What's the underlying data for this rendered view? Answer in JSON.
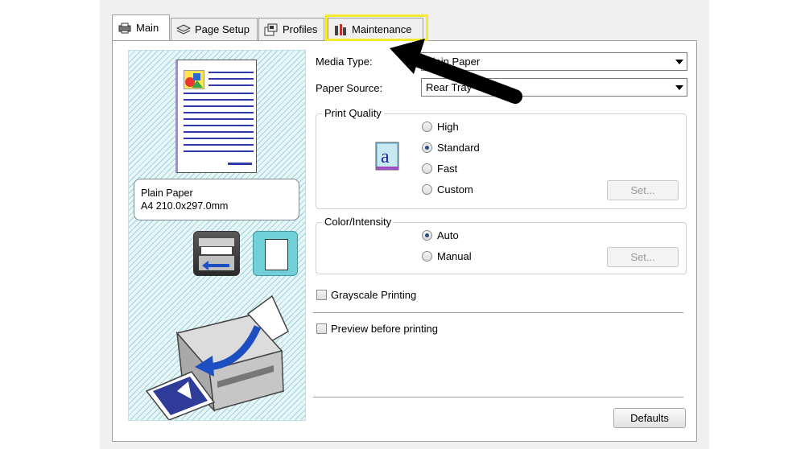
{
  "tabs": [
    {
      "label": "Main",
      "icon": "printer-icon",
      "active": true
    },
    {
      "label": "Page Setup",
      "icon": "page-layers-icon",
      "active": false
    },
    {
      "label": "Profiles",
      "icon": "profiles-icon",
      "active": false
    },
    {
      "label": "Maintenance",
      "icon": "maintenance-tools-icon",
      "active": false
    }
  ],
  "preview": {
    "paper_line1": "Plain Paper",
    "paper_line2": "A4 210.0x297.0mm"
  },
  "media_type": {
    "label": "Media Type:",
    "value": "Plain Paper"
  },
  "paper_source": {
    "label": "Paper Source:",
    "value": "Rear Tray"
  },
  "print_quality": {
    "title": "Print Quality",
    "options": [
      "High",
      "Standard",
      "Fast",
      "Custom"
    ],
    "selected": "Standard",
    "set_label": "Set..."
  },
  "color_intensity": {
    "title": "Color/Intensity",
    "options": [
      "Auto",
      "Manual"
    ],
    "selected": "Auto",
    "set_label": "Set..."
  },
  "grayscale_label": "Grayscale Printing",
  "preview_label": "Preview before printing",
  "defaults_label": "Defaults",
  "colors": {
    "highlight": "#f3ea2e",
    "preview_bg": "#e9f6f8",
    "arrow": "#000000"
  }
}
